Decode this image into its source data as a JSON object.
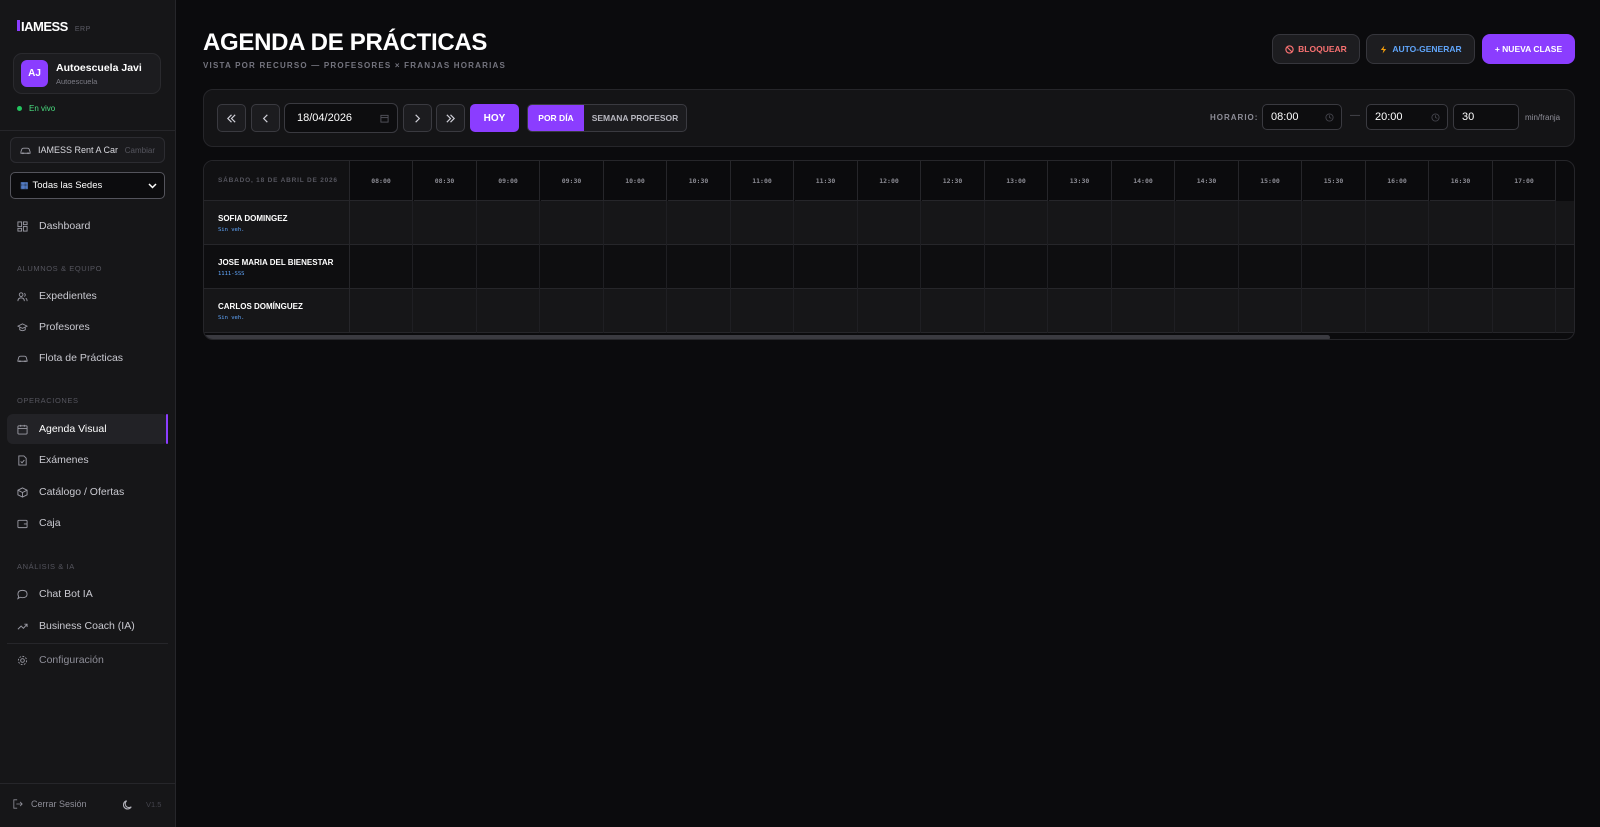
{
  "sidebar": {
    "logo": "IAMESS",
    "logo_sub": "ERP",
    "account": {
      "initials": "AJ",
      "name": "Autoescuela Javi",
      "role": "Autoescuela"
    },
    "status": "En vivo",
    "company": {
      "name": "IAMESS Rent A Car",
      "change": "Cambiar"
    },
    "sede": "Todas las Sedes",
    "items": {
      "dashboard": "Dashboard",
      "section_alumnos": "ALUMNOS & EQUIPO",
      "expedientes": "Expedientes",
      "profesores": "Profesores",
      "flota": "Flota de Prácticas",
      "section_operaciones": "OPERACIONES",
      "agenda": "Agenda Visual",
      "examenes": "Exámenes",
      "catalogo": "Catálogo / Ofertas",
      "caja": "Caja",
      "section_analisis": "ANÁLISIS & IA",
      "chatbot": "Chat Bot IA",
      "coach": "Business Coach (IA)",
      "config": "Configuración"
    },
    "logout": "Cerrar Sesión",
    "version": "V1.5"
  },
  "header": {
    "title": "AGENDA DE PRÁCTICAS",
    "subtitle": "VISTA POR RECURSO — PROFESORES × FRANJAS HORARIAS",
    "block_label": "BLOQUEAR",
    "auto_label": "AUTO-GENERAR",
    "new_label": "+ NUEVA CLASE"
  },
  "toolbar": {
    "date": "18/04/2026",
    "today": "HOY",
    "view_day": "POR DÍA",
    "view_week": "SEMANA PROFESOR",
    "schedule_label": "HORARIO:",
    "start": "08:00",
    "end": "20:00",
    "interval": "30",
    "interval_unit": "min/franja"
  },
  "grid": {
    "date_label": "SÁBADO, 18 DE ABRIL DE 2026",
    "slots": [
      "08:00",
      "08:30",
      "09:00",
      "09:30",
      "10:00",
      "10:30",
      "11:00",
      "11:30",
      "12:00",
      "12:30",
      "13:00",
      "13:30",
      "14:00",
      "14:30",
      "15:00",
      "15:30",
      "16:00",
      "16:30",
      "17:00"
    ],
    "resources": [
      {
        "name": "SOFIA DOMINGEZ",
        "vehicle": "Sin veh."
      },
      {
        "name": "JOSE MARIA DEL BIENESTAR",
        "vehicle": "1111-SSS"
      },
      {
        "name": "CARLOS DOMÍNGUEZ",
        "vehicle": "Sin veh."
      }
    ]
  },
  "colors": {
    "accent": "#8b3dff",
    "live": "#22c55e",
    "danger": "#f87171",
    "info": "#60a5fa"
  }
}
